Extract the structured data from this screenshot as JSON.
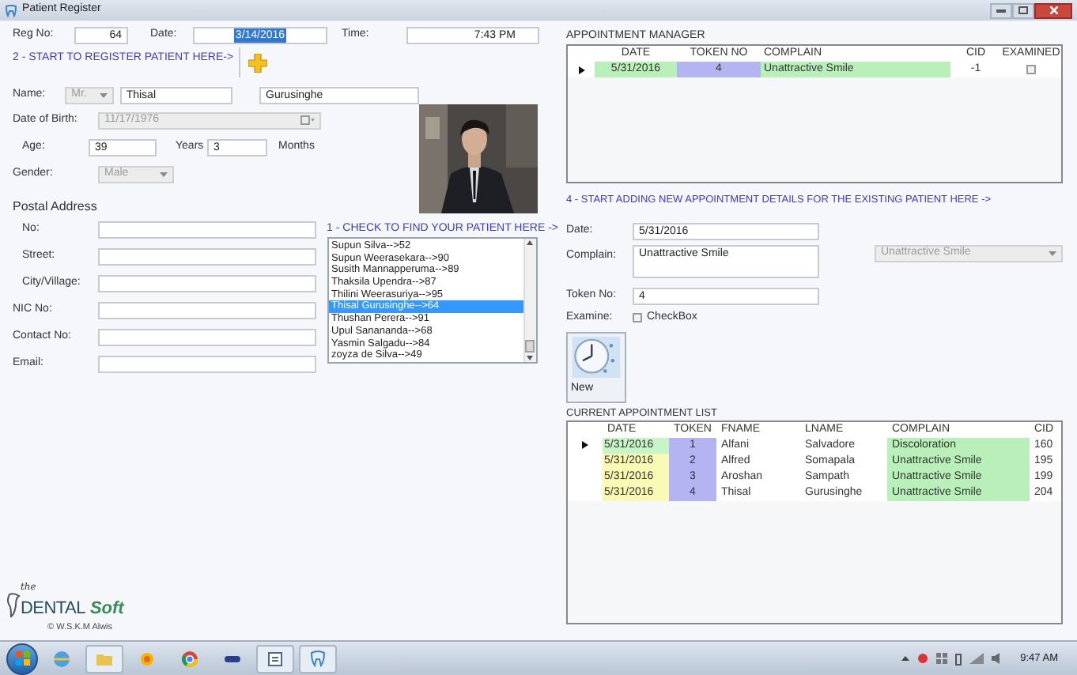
{
  "window": {
    "title": "Patient Register"
  },
  "registration": {
    "reg_no_label": "Reg No:",
    "reg_no": "64",
    "date_label": "Date:",
    "date": "3/14/2016",
    "time_label": "Time:",
    "time": "7:43 PM"
  },
  "register_hint": "2 - START TO REGISTER PATIENT HERE->",
  "patient": {
    "name_label": "Name:",
    "title": {
      "value": "Mr.",
      "disabled": true
    },
    "first_name": "Thisal",
    "last_name": "Gurusinghe",
    "dob_label": "Date of Birth:",
    "dob": {
      "value": "11/17/1976",
      "disabled": true
    },
    "age_label": "Age:",
    "age_years": "39",
    "years_label": "Years",
    "age_months": "3",
    "months_label": "Months",
    "gender_label": "Gender:",
    "gender": {
      "value": "Male",
      "disabled": true
    }
  },
  "postal_address": {
    "heading": "Postal Address",
    "fields": [
      {
        "label": "No:",
        "indent": true
      },
      {
        "label": "Street:",
        "indent": true
      },
      {
        "label": "City/Village:",
        "indent": true
      },
      {
        "label": "NIC No:",
        "indent": false
      },
      {
        "label": "Contact No:",
        "indent": false
      },
      {
        "label": "Email:",
        "indent": false
      }
    ]
  },
  "find_hint": "1 - CHECK TO FIND YOUR PATIENT HERE ->",
  "patient_list": [
    {
      "label": "Supun Silva-->52",
      "selected": false
    },
    {
      "label": "Supun Weerasekara-->90",
      "selected": false
    },
    {
      "label": "Susith Mannapperuma-->89",
      "selected": false
    },
    {
      "label": "Thaksila Upendra-->87",
      "selected": false
    },
    {
      "label": "Thilini Weerasuriya-->95",
      "selected": false
    },
    {
      "label": "Thisal Gurusinghe-->64",
      "selected": true
    },
    {
      "label": "Thushan Perera-->91",
      "selected": false
    },
    {
      "label": "Upul Sanananda-->68",
      "selected": false
    },
    {
      "label": "Yasmin Salgadu-->84",
      "selected": false
    },
    {
      "label": "zoyza de Silva-->49",
      "selected": false
    }
  ],
  "appointment_manager": {
    "title": "APPOINTMENT MANAGER",
    "columns": [
      "DATE",
      "TOKEN NO",
      "COMPLAIN",
      "CID",
      "EXAMINED"
    ],
    "rows": [
      {
        "date": "5/31/2016",
        "token": "4",
        "complain": "Unattractive Smile",
        "cid": "-1",
        "examined": false,
        "selected": true
      }
    ]
  },
  "add_hint": "4 - START ADDING NEW APPOINTMENT DETAILS FOR THE EXISTING PATIENT HERE ->",
  "appointment_form": {
    "date_label": "Date:",
    "date": "5/31/2016",
    "complain_label": "Complain:",
    "complain": "Unattractive Smile",
    "complain_choice": {
      "value": "Unattractive Smile",
      "disabled": true
    },
    "token_label": "Token No:",
    "token": "4",
    "examine_label": "Examine:",
    "checkbox_label": "CheckBox",
    "examined": false,
    "new_button": "New"
  },
  "current_list": {
    "title": "CURRENT APPOINTMENT LIST",
    "columns": [
      "DATE",
      "TOKEN",
      "FNAME",
      "LNAME",
      "COMPLAIN",
      "CID"
    ],
    "rows": [
      {
        "date": "5/31/2016",
        "color": "#c8f5c8",
        "token": "1",
        "fname": "Alfani",
        "lname": "Salvadore",
        "complain": "Discoloration",
        "cid": "160",
        "selected": true
      },
      {
        "date": "5/31/2016",
        "color": "#fafab4",
        "token": "2",
        "fname": "Alfred",
        "lname": "Somapala",
        "complain": "Unattractive Smile",
        "cid": "195",
        "selected": false
      },
      {
        "date": "5/31/2016",
        "color": "#fafab4",
        "token": "3",
        "fname": "Aroshan",
        "lname": "Sampath",
        "complain": "Unattractive Smile",
        "cid": "199",
        "selected": false
      },
      {
        "date": "5/31/2016",
        "color": "#fafab4",
        "token": "4",
        "fname": "Thisal",
        "lname": "Gurusinghe",
        "complain": "Unattractive Smile",
        "cid": "204",
        "selected": false
      }
    ]
  },
  "logo": {
    "prefix": "the",
    "name": "DENTAL",
    "suffix": "Soft",
    "credit": "© W.S.K.M Alwis"
  },
  "taskbar": {
    "time": "9:47 AM"
  }
}
